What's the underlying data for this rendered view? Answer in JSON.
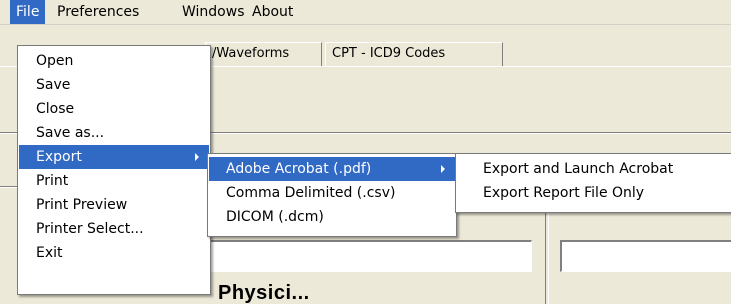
{
  "menubar": {
    "items": [
      {
        "label": "File"
      },
      {
        "label": "Preferences"
      },
      {
        "label": "Windows"
      },
      {
        "label": "About"
      }
    ]
  },
  "background": {
    "tabs": [
      {
        "label": "/Waveforms"
      },
      {
        "label": "CPT - ICD9 Codes"
      }
    ],
    "partial_heading": "Physici..."
  },
  "file_menu": {
    "items": [
      {
        "label": "Open"
      },
      {
        "label": "Save"
      },
      {
        "label": "Close"
      },
      {
        "label": "Save as..."
      },
      {
        "label": "Export"
      },
      {
        "label": "Print"
      },
      {
        "label": "Print Preview"
      },
      {
        "label": "Printer Select..."
      },
      {
        "label": "Exit"
      }
    ]
  },
  "export_menu": {
    "items": [
      {
        "label": "Adobe Acrobat (.pdf)"
      },
      {
        "label": "Comma Delimited (.csv)"
      },
      {
        "label": "DICOM (.dcm)"
      }
    ]
  },
  "acrobat_menu": {
    "items": [
      {
        "label": "Export and Launch Acrobat"
      },
      {
        "label": "Export Report File Only"
      }
    ]
  },
  "colors": {
    "highlight": "#316ac5",
    "window_bg": "#ece9d8"
  }
}
